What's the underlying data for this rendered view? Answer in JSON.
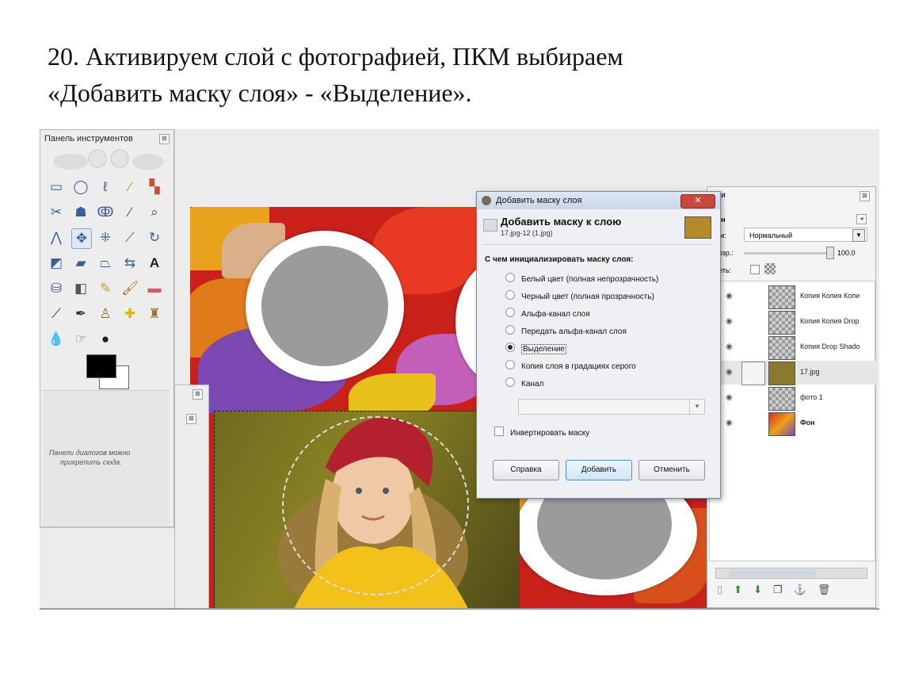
{
  "caption": {
    "line1": "20. Активируем слой с фотографией,  ПКМ выбираем",
    "line2": "«Добавить маску слоя» - «Выделение»."
  },
  "toolbox": {
    "title": "Панель инструментов",
    "tools": [
      "rect-select",
      "ellipse-select",
      "free-select",
      "fuzzy-select",
      "color-select",
      "scissors",
      "foreground-select",
      "paths",
      "color-picker",
      "zoom",
      "measure",
      "move",
      "align",
      "crop",
      "rotate",
      "scale",
      "shear",
      "perspective",
      "flip",
      "text",
      "bucket-fill",
      "blend",
      "pencil",
      "paintbrush",
      "eraser",
      "airbrush",
      "ink",
      "clone",
      "heal",
      "perspective-clone",
      "blur",
      "smudge",
      "dodge"
    ],
    "dock_note_line1": "Панели диалогов можно",
    "dock_note_line2": "прикрепить сюда."
  },
  "dialog": {
    "title": "Добавить маску слоя",
    "heading": "Добавить маску к слою",
    "subheading": "17.jpg-12 (1.jpg)",
    "question": "С чем инициализировать маску слоя:",
    "options": [
      {
        "label": "Белый цвет (полная непрозрачность)",
        "checked": false
      },
      {
        "label": "Черный цвет (полная прозрачность)",
        "checked": false
      },
      {
        "label": "Альфа-канал слоя",
        "checked": false
      },
      {
        "label": "Передать альфа-канал слоя",
        "checked": false
      },
      {
        "label": "Выделение",
        "checked": true
      },
      {
        "label": "Копия слоя в градациях серого",
        "checked": false
      },
      {
        "label": "Канал",
        "checked": false
      }
    ],
    "invert_label": "Инвертировать маску",
    "btn_help": "Справка",
    "btn_add": "Добавить",
    "btn_cancel": "Отменить",
    "close_glyph": "✕"
  },
  "layers": {
    "title_fragment": "Фои",
    "tab_fragment": "Фон",
    "mode_label_fragment": "жим:",
    "mode_value": "Нормальный",
    "opacity_label_fragment": "прозр.:",
    "opacity_value": "100.0",
    "lock_label_fragment": "ереть:",
    "items": [
      {
        "name": "Копия Копия Копи"
      },
      {
        "name": "Копия Копия Drop"
      },
      {
        "name": "Копия Drop Shado"
      },
      {
        "name": "17.jpg"
      },
      {
        "name": "фото 1"
      },
      {
        "name": "Фон"
      }
    ]
  },
  "colors": {
    "accent": "#4b8fd6",
    "close_red": "#c9473b"
  }
}
